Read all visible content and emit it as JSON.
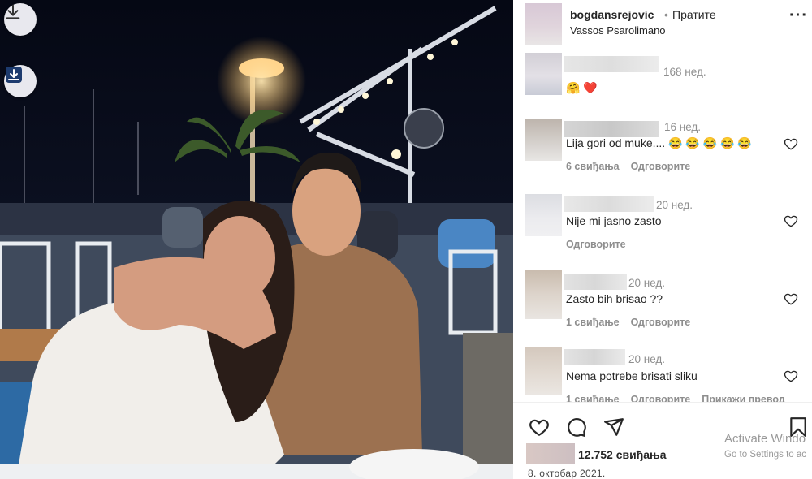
{
  "post": {
    "username": "bogdansrejovic",
    "separator": "•",
    "follow_label": "Пратите",
    "location": "Vassos Psarolimano",
    "more_label": "···"
  },
  "comments": [
    {
      "age": "168 нед.",
      "text": "🤗 ❤️",
      "likes": "",
      "reply": "",
      "extra": ""
    },
    {
      "age": "16 нед.",
      "text": "Lija gori od muke.... 😂 😂 😂 😂 😂",
      "likes": "6 свиђања",
      "reply": "Одговорите",
      "extra": ""
    },
    {
      "age": "20 нед.",
      "text": "Nije mi jasno zasto",
      "likes": "",
      "reply": "Одговорите",
      "extra": ""
    },
    {
      "age": "20 нед.",
      "text": "Zasto bih brisao ??",
      "likes": "1 свиђање",
      "reply": "Одговорите",
      "extra": ""
    },
    {
      "age": "20 нед.",
      "text": "Nema potrebe brisati sliku",
      "likes": "1 свиђање",
      "reply": "Одговорите",
      "extra": "Прикажи превод"
    }
  ],
  "footer": {
    "likes_count": "12.752 свиђања",
    "date": "8. октобар 2021.",
    "windows_title": "Activate Windo",
    "windows_sub": "Go to Settings to ac"
  },
  "icons": {
    "download": "download-icon",
    "save": "save-image-icon",
    "like": "heart-icon",
    "comment": "comment-icon",
    "share": "share-icon",
    "bookmark": "bookmark-icon"
  },
  "colors": {
    "text": "#262626",
    "muted": "#8e8e8e",
    "heart_red": "#ed4956"
  }
}
